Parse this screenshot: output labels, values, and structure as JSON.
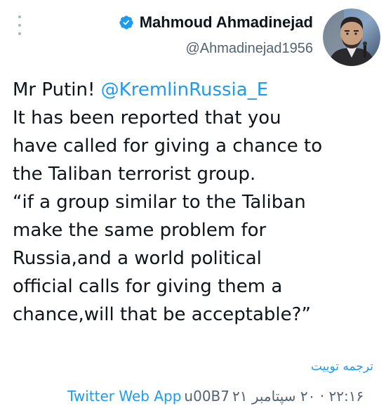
{
  "tweet": {
    "author": {
      "display_name": "Mahmoud Ahmadinejad",
      "handle": "@Ahmadinejad1956",
      "verified": true
    },
    "body": {
      "line1_text": "Mr Putin! ",
      "line1_mention": "@KremlinRussia_E",
      "lines": [
        "It has been reported that you",
        "have called for giving a chance to",
        "the Taliban terrorist group.",
        "“if a group similar to the Taliban",
        "make the same problem for",
        "Russia,and a world political",
        "official calls for giving them a",
        "chance,will that be acceptable?”"
      ]
    },
    "translate_label": "ترجمه توییت",
    "timestamp": "۲۲:۱۶ · ۲۰ سپتامبر ۲۱",
    "separator": "u00B7",
    "source_app": "Twitter Web App"
  },
  "colors": {
    "accent": "#1d9bf0",
    "text_primary": "#0f1419",
    "text_secondary": "#536471",
    "more_dots": "#aab8c2"
  },
  "icons": {
    "more": "more-vertical-icon",
    "verified": "verified-badge-icon"
  }
}
